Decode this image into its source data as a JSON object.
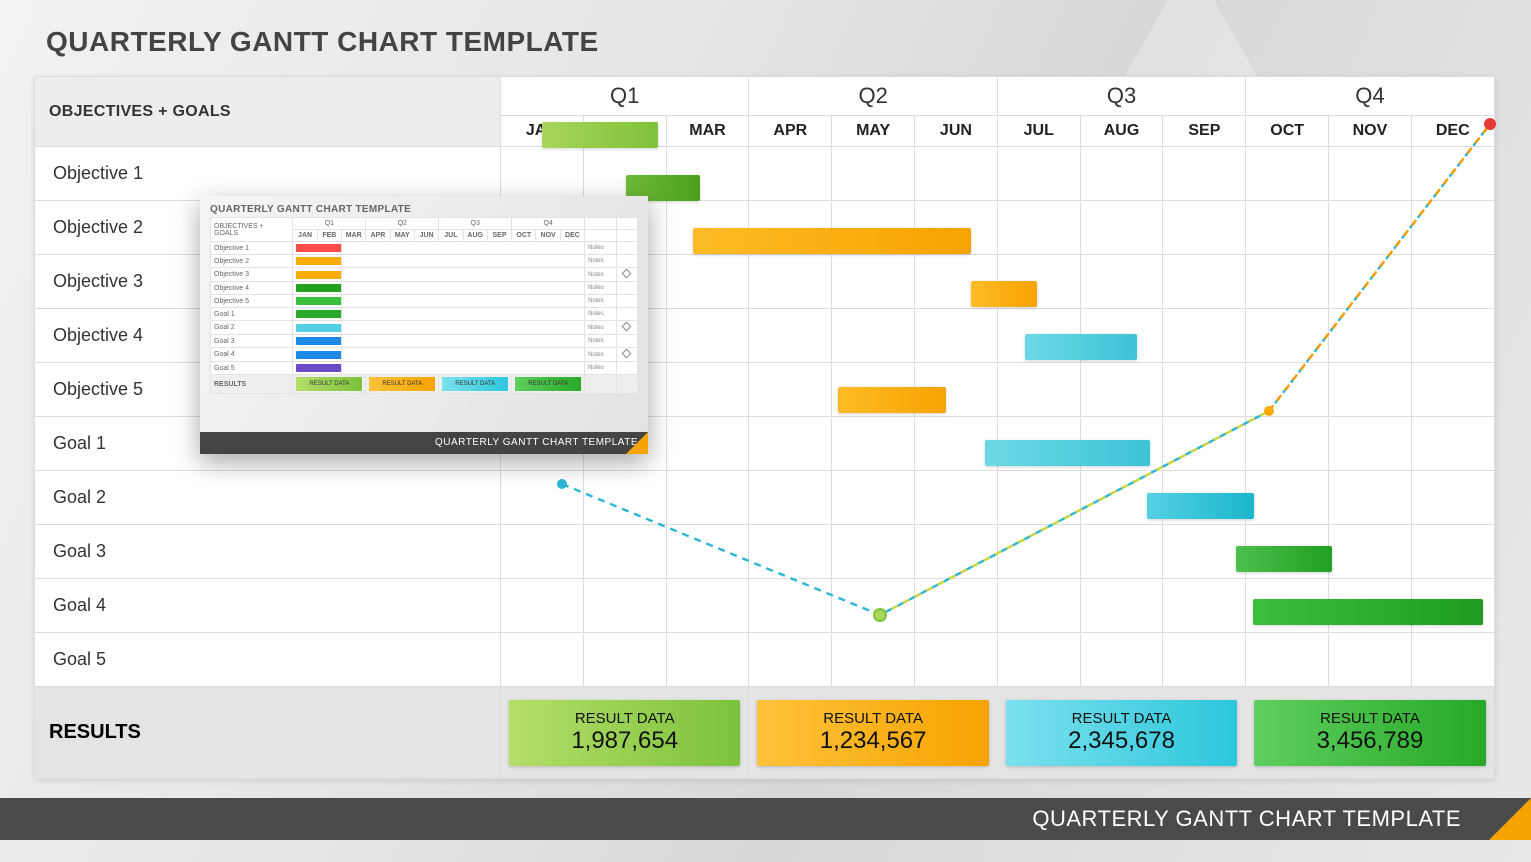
{
  "title": "QUARTERLY GANTT CHART TEMPLATE",
  "footer": "QUARTERLY GANTT CHART TEMPLATE",
  "columns_title": "OBJECTIVES + GOALS",
  "quarters": [
    "Q1",
    "Q2",
    "Q3",
    "Q4"
  ],
  "months": [
    "JAN",
    "FEB",
    "MAR",
    "APR",
    "MAY",
    "JUN",
    "JUL",
    "AUG",
    "SEP",
    "OCT",
    "NOV",
    "DEC"
  ],
  "rows": [
    "Objective 1",
    "Objective 2",
    "Objective 3",
    "Objective 4",
    "Objective 5",
    "Goal 1",
    "Goal 2",
    "Goal 3",
    "Goal 4",
    "Goal 5"
  ],
  "results_label": "RESULTS",
  "result_title": "RESULT DATA",
  "results": [
    "1,987,654",
    "1,234,567",
    "2,345,678",
    "3,456,789"
  ],
  "chart_data": {
    "type": "gantt",
    "title": "Quarterly Gantt Chart Template",
    "xlabel": "",
    "ylabel": "",
    "x_categories": [
      "JAN",
      "FEB",
      "MAR",
      "APR",
      "MAY",
      "JUN",
      "JUL",
      "AUG",
      "SEP",
      "OCT",
      "NOV",
      "DEC"
    ],
    "x_groups": {
      "Q1": [
        "JAN",
        "FEB",
        "MAR"
      ],
      "Q2": [
        "APR",
        "MAY",
        "JUN"
      ],
      "Q3": [
        "JUL",
        "AUG",
        "SEP"
      ],
      "Q4": [
        "OCT",
        "NOV",
        "DEC"
      ]
    },
    "tasks": [
      {
        "name": "Objective 1",
        "start": "JAN",
        "end": "FEB",
        "start_offset": 0.1,
        "end_offset": 0.5,
        "color": "#8fca3f"
      },
      {
        "name": "Objective 2",
        "start": "FEB",
        "end": "MAR",
        "start_offset": 0.1,
        "end_offset": 0.0,
        "color": "#5fb229"
      },
      {
        "name": "Objective 3",
        "start": "APR",
        "end": "JUN",
        "start_offset": 0.0,
        "end_offset": 0.6,
        "color": "#f7ab00"
      },
      {
        "name": "Objective 4",
        "start": "JUL",
        "end": "JUL",
        "start_offset": 0.0,
        "end_offset": 0.8,
        "color": "#f7ab00"
      },
      {
        "name": "Objective 5",
        "start": "AUG",
        "end": "SEP",
        "start_offset": -0.15,
        "end_offset": 0.2,
        "color": "#3fc9db"
      },
      {
        "name": "Goal 1",
        "start": "MAY",
        "end": "JUN",
        "start_offset": -0.1,
        "end_offset": 0.2,
        "color": "#f7ab00"
      },
      {
        "name": "Goal 2",
        "start": "JUL",
        "end": "SEP",
        "start_offset": 0.0,
        "end_offset": 0.0,
        "color": "#3fc9db"
      },
      {
        "name": "Goal 3",
        "start": "SEP",
        "end": "OCT",
        "start_offset": 0.0,
        "end_offset": 0.3,
        "color": "#40cde0"
      },
      {
        "name": "Goal 4",
        "start": "OCT",
        "end": "NOV",
        "start_offset": 0.0,
        "end_offset": 0.15,
        "color": "#34b534"
      },
      {
        "name": "Goal 5",
        "start": "OCT",
        "end": "DEC",
        "start_offset": 0.2,
        "end_offset": 1.0,
        "color": "#2aa82a"
      }
    ],
    "trend_points": [
      {
        "month": "JAN",
        "row": 7,
        "color": "#2bb7d3"
      },
      {
        "month": "MAY",
        "row": 10,
        "color": "#8fca3f"
      },
      {
        "month": "OCT",
        "row": 6,
        "color": "#f7ab00"
      },
      {
        "month": "DEC",
        "row": 1,
        "color": "#e53935"
      }
    ],
    "quarterly_results": [
      {
        "quarter": "Q1",
        "label": "RESULT DATA",
        "value": 1987654,
        "color": "#8fca3f"
      },
      {
        "quarter": "Q2",
        "label": "RESULT DATA",
        "value": 1234567,
        "color": "#f7ab00"
      },
      {
        "quarter": "Q3",
        "label": "RESULT DATA",
        "value": 2345678,
        "color": "#3fc9db"
      },
      {
        "quarter": "Q4",
        "label": "RESULT DATA",
        "value": 3456789,
        "color": "#2aa82a"
      }
    ]
  },
  "thumb": {
    "title": "QUARTERLY GANTT CHART TEMPLATE",
    "columns_title": "OBJECTIVES + GOALS",
    "rows": [
      "Objective 1",
      "Objective 2",
      "Objective 3",
      "Objective 4",
      "Objective 5",
      "Goal 1",
      "Goal 2",
      "Goal 3",
      "Goal 4",
      "Goal 5"
    ],
    "notes": "Notes",
    "results_label": "RESULTS",
    "result_title": "RESULT DATA",
    "footer": "QUARTERLY GANTT CHART TEMPLATE",
    "bar_colors": [
      "#ff4d4d",
      "#f7ab00",
      "#f7ab00",
      "#22a022",
      "#3abf3a",
      "#2aa82a",
      "#55d0e3",
      "#1e88e5",
      "#1e88e5",
      "#6a4cc4"
    ],
    "diamond_rows": [
      2,
      6,
      8
    ]
  }
}
